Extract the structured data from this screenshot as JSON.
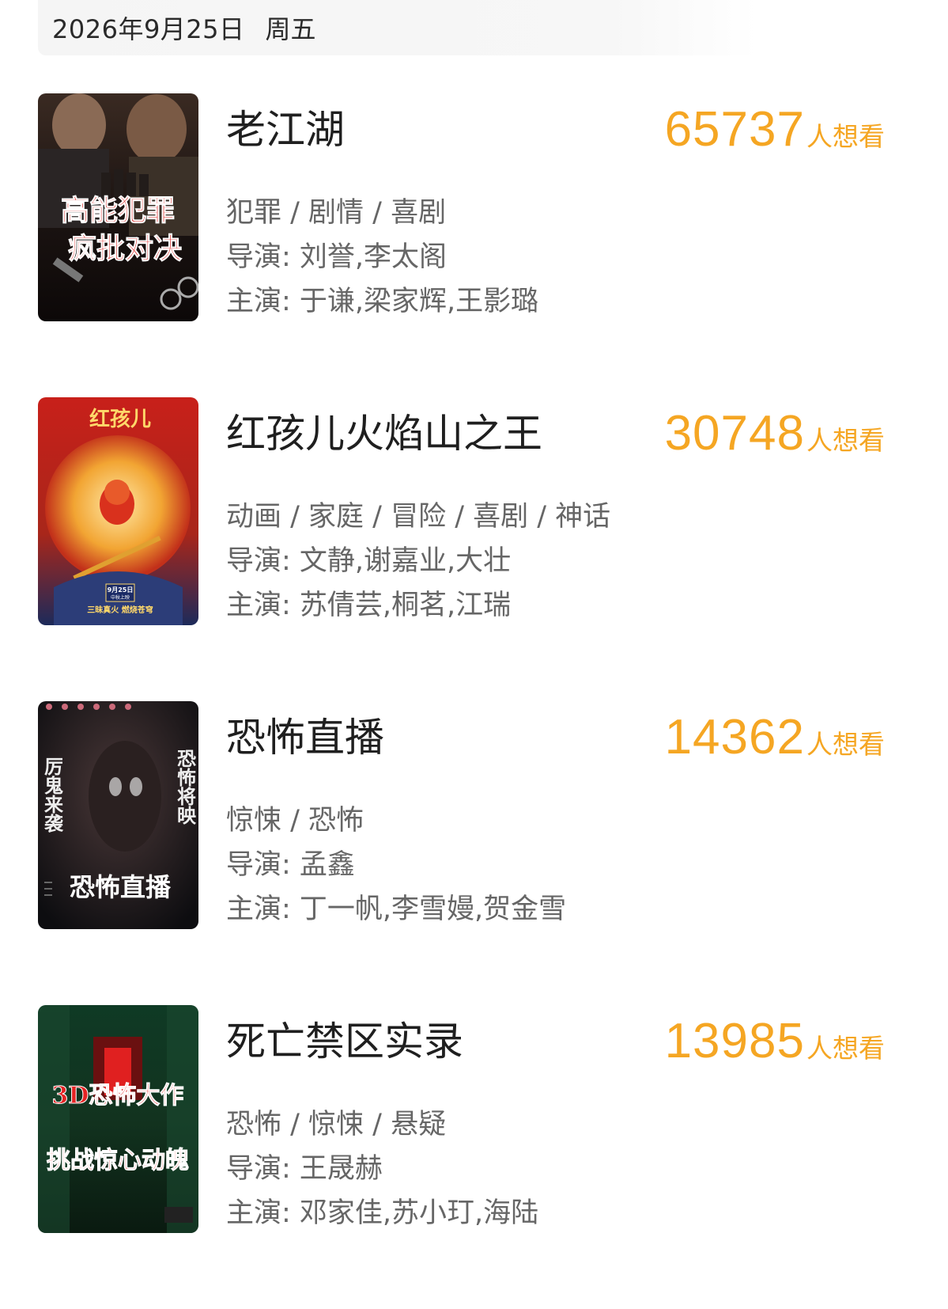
{
  "header": {
    "date": "2026年9月25日",
    "weekday": "周五"
  },
  "movies": [
    {
      "title": "老江湖",
      "want_count": "65737",
      "want_label": "人想看",
      "genres": "犯罪 / 剧情 / 喜剧",
      "director": "导演: 刘誉,李太阁",
      "cast": "主演: 于谦,梁家辉,王影璐",
      "poster_text": [
        "高能犯罪",
        "疯批对决"
      ]
    },
    {
      "title": "红孩儿火焰山之王",
      "want_count": "30748",
      "want_label": "人想看",
      "genres": "动画 / 家庭 / 冒险 / 喜剧 / 神话",
      "director": "导演: 文静,谢嘉业,大壮",
      "cast": "主演: 苏倩芸,桐茗,江瑞",
      "poster_text": [
        "红孩儿",
        "9月25日",
        "中秋上映",
        "三昧真火 燃烧苍穹"
      ]
    },
    {
      "title": "恐怖直播",
      "want_count": "14362",
      "want_label": "人想看",
      "genres": "惊悚 / 恐怖",
      "director": "导演: 孟鑫",
      "cast": "主演: 丁一帆,李雪嫚,贺金雪",
      "poster_text": [
        "厉鬼来袭",
        "恐怖将映",
        "恐怖直播"
      ]
    },
    {
      "title": "死亡禁区实录",
      "want_count": "13985",
      "want_label": "人想看",
      "genres": "恐怖 / 惊悚 / 悬疑",
      "director": "导演: 王晟赫",
      "cast": "主演: 邓家佳,苏小玎,海陆",
      "poster_text": [
        "3D恐怖大作",
        "挑战惊心动魄"
      ]
    }
  ],
  "colors": {
    "accent": "#f5a623",
    "title": "#1f1f1f",
    "meta": "#666666",
    "date_bar_bg": "#f5f5f5"
  }
}
